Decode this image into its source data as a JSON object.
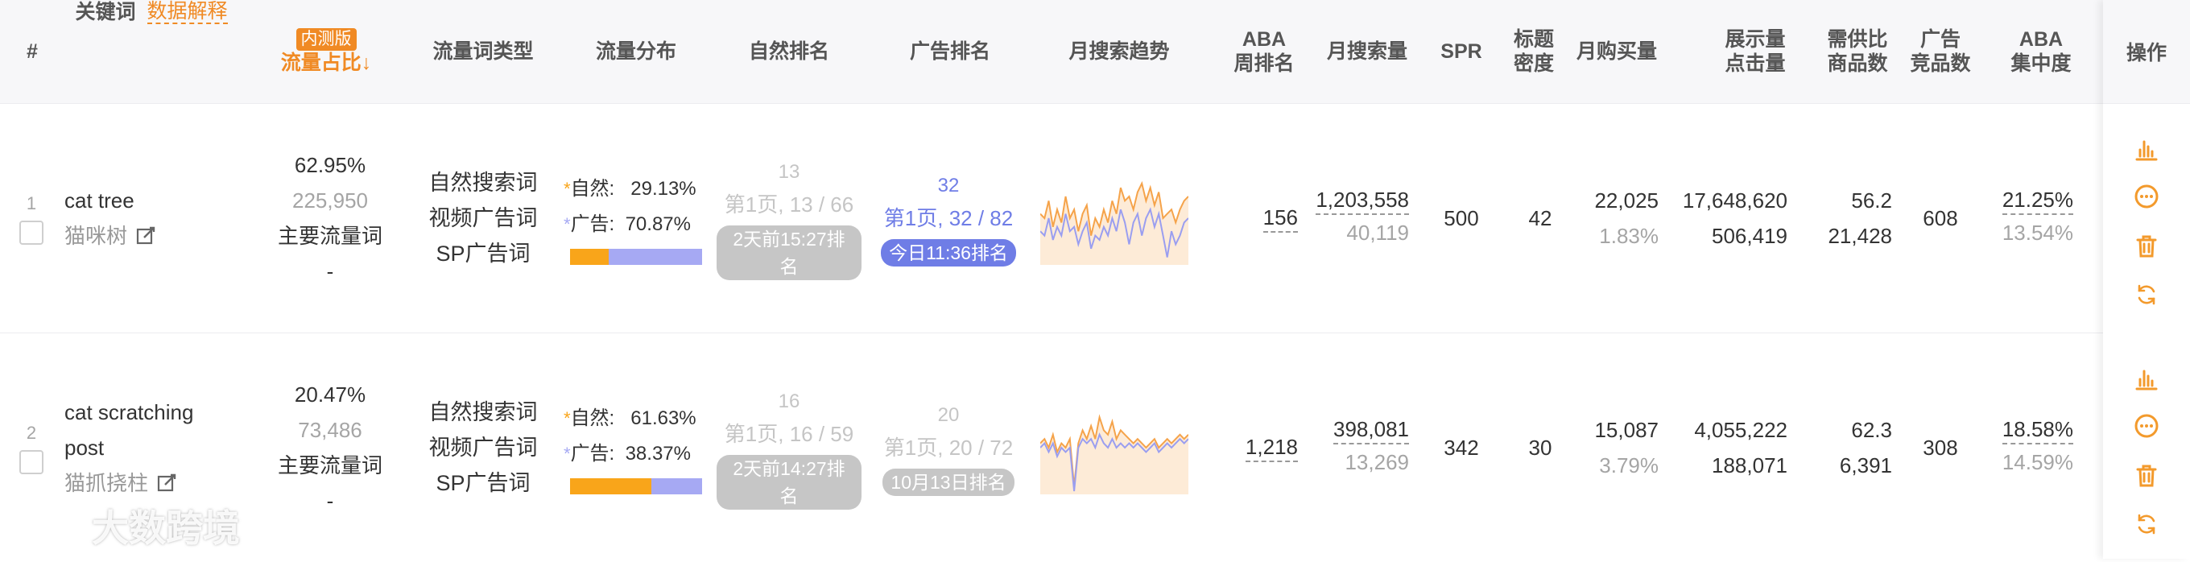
{
  "header": {
    "index": "#",
    "keyword": "关键词",
    "data_explain": "数据解释",
    "internal_badge": "内测版",
    "traffic_share": "流量占比↓",
    "keyword_type": "流量词类型",
    "traffic_dist": "流量分布",
    "natural_rank": "自然排名",
    "ad_rank": "广告排名",
    "monthly_trend": "月搜索趋势",
    "aba_weekly_1": "ABA",
    "aba_weekly_2": "周排名",
    "monthly_search": "月搜索量",
    "spr": "SPR",
    "title_density_1": "标题",
    "title_density_2": "密度",
    "monthly_purchase": "月购买量",
    "impr_1": "展示量",
    "impr_2": "点击量",
    "supply_1": "需供比",
    "supply_2": "商品数",
    "ad_comp_1": "广告",
    "ad_comp_2": "竞品数",
    "aba_conc_1": "ABA",
    "aba_conc_2": "集中度",
    "actions": "操作"
  },
  "rows": [
    {
      "index": "1",
      "keyword_en": "cat tree",
      "keyword_en_2": "",
      "keyword_cn": "猫咪树",
      "traffic_pct": "62.95%",
      "traffic_count": "225,950",
      "traffic_label": "主要流量词",
      "traffic_dash": "-",
      "types": [
        "自然搜索词",
        "视频广告词",
        "SP广告词"
      ],
      "dist_natural_label": "自然:",
      "dist_natural_pct": "29.13%",
      "dist_ad_label": "广告:",
      "dist_ad_pct": "70.87%",
      "dist_natural_fraction": 0.2913,
      "natural_rank_num": "13",
      "natural_rank_page": "第1页, 13 / 66",
      "natural_rank_badge": "2天前15:27排名",
      "ad_rank_num": "32",
      "ad_rank_page": "第1页, 32 / 82",
      "ad_rank_badge": "今日11:36排名",
      "trend_orange": [
        0.55,
        0.5,
        0.7,
        0.4,
        0.6,
        0.45,
        0.75,
        0.5,
        0.6,
        0.35,
        0.55,
        0.65,
        0.3,
        0.5,
        0.4,
        0.6,
        0.45,
        0.7,
        0.55,
        0.85,
        0.7,
        0.75,
        0.6,
        0.8,
        0.9,
        0.7,
        0.85,
        0.65,
        0.8,
        0.5,
        0.55,
        0.6,
        0.45,
        0.6,
        0.7,
        0.75
      ],
      "trend_purple": [
        0.35,
        0.3,
        0.5,
        0.25,
        0.4,
        0.3,
        0.55,
        0.35,
        0.4,
        0.2,
        0.35,
        0.45,
        0.15,
        0.3,
        0.25,
        0.4,
        0.3,
        0.5,
        0.35,
        0.6,
        0.45,
        0.2,
        0.45,
        0.55,
        0.3,
        0.5,
        0.6,
        0.4,
        0.55,
        0.3,
        0.05,
        0.35,
        0.2,
        0.3,
        0.45,
        0.5
      ],
      "aba_weekly": "156",
      "monthly_search": "1,203,558",
      "monthly_search_sub": "40,119",
      "spr": "500",
      "title_density": "42",
      "monthly_purchase": "22,025",
      "monthly_purchase_pct": "1.83%",
      "impressions": "17,648,620",
      "clicks": "506,419",
      "supply_ratio": "56.2",
      "product_count": "21,428",
      "ad_competitors": "608",
      "aba_conc": "21.25%",
      "aba_conc_sub": "13.54%"
    },
    {
      "index": "2",
      "keyword_en": "cat scratching",
      "keyword_en_2": "post",
      "keyword_cn": "猫抓挠柱",
      "traffic_pct": "20.47%",
      "traffic_count": "73,486",
      "traffic_label": "主要流量词",
      "traffic_dash": "-",
      "types": [
        "自然搜索词",
        "视频广告词",
        "SP广告词"
      ],
      "dist_natural_label": "自然:",
      "dist_natural_pct": "61.63%",
      "dist_ad_label": "广告:",
      "dist_ad_pct": "38.37%",
      "dist_natural_fraction": 0.6163,
      "natural_rank_num": "16",
      "natural_rank_page": "第1页, 16 / 59",
      "natural_rank_badge": "2天前14:27排名",
      "ad_rank_num": "20",
      "ad_rank_page": "第1页, 20 / 72",
      "ad_rank_badge": "10月13日排名",
      "trend_orange": [
        0.55,
        0.6,
        0.5,
        0.65,
        0.45,
        0.55,
        0.5,
        0.6,
        0.05,
        0.55,
        0.7,
        0.6,
        0.75,
        0.6,
        0.85,
        0.7,
        0.65,
        0.8,
        0.6,
        0.7,
        0.65,
        0.6,
        0.55,
        0.6,
        0.55,
        0.5,
        0.55,
        0.6,
        0.5,
        0.55,
        0.6,
        0.55,
        0.6,
        0.65,
        0.6,
        0.65
      ],
      "trend_purple": [
        0.5,
        0.55,
        0.45,
        0.55,
        0.4,
        0.5,
        0.45,
        0.5,
        0.0,
        0.5,
        0.6,
        0.55,
        0.6,
        0.5,
        0.65,
        0.55,
        0.5,
        0.6,
        0.5,
        0.55,
        0.5,
        0.55,
        0.5,
        0.55,
        0.5,
        0.45,
        0.5,
        0.55,
        0.45,
        0.5,
        0.55,
        0.5,
        0.55,
        0.6,
        0.55,
        0.6
      ],
      "aba_weekly": "1,218",
      "monthly_search": "398,081",
      "monthly_search_sub": "13,269",
      "spr": "342",
      "title_density": "30",
      "monthly_purchase": "15,087",
      "monthly_purchase_pct": "3.79%",
      "impressions": "4,055,222",
      "clicks": "188,071",
      "supply_ratio": "62.3",
      "product_count": "6,391",
      "ad_competitors": "308",
      "aba_conc": "18.58%",
      "aba_conc_sub": "14.59%"
    }
  ],
  "colors": {
    "accent_orange": "#f08a24",
    "bar_orange": "#f9a51a",
    "bar_purple": "#a6a9f3",
    "link_blue": "#6f7de6",
    "icon_orange": "#f39a2c"
  },
  "watermark": "大数跨境"
}
